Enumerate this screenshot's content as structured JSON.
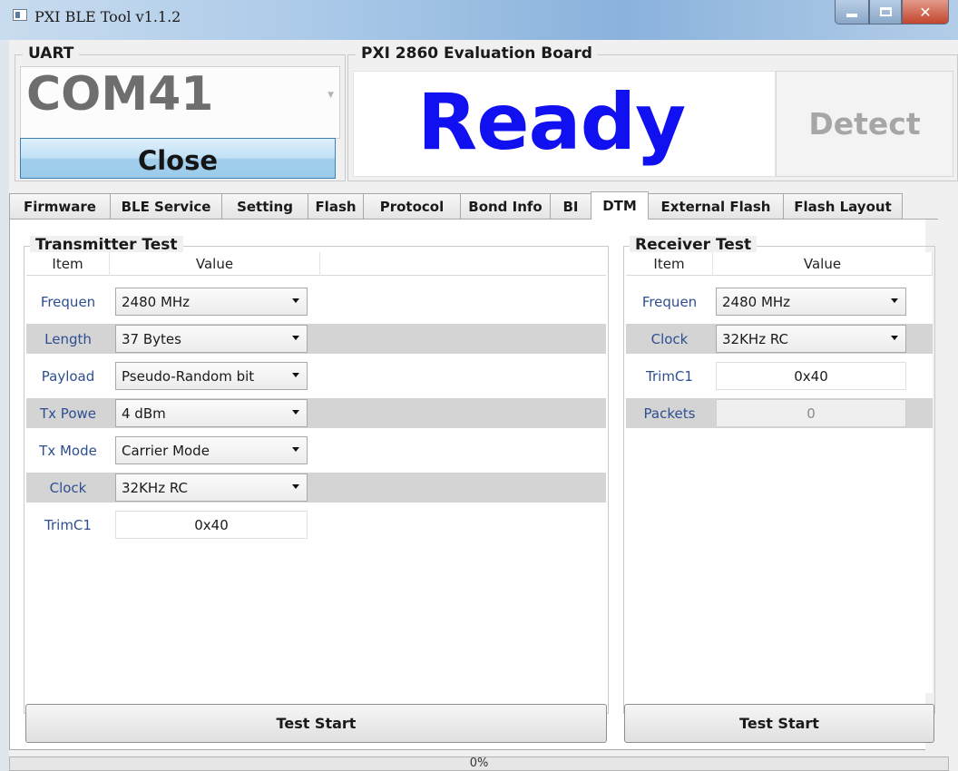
{
  "window": {
    "title": "PXI BLE Tool v1.1.2"
  },
  "uart": {
    "group_label": "UART",
    "port": "COM41",
    "close_label": "Close"
  },
  "board": {
    "group_label": "PXI 2860 Evaluation Board",
    "status": "Ready",
    "status_color": "#1010f0",
    "detect_label": "Detect"
  },
  "tabs": [
    {
      "label": "Firmware"
    },
    {
      "label": "BLE Service"
    },
    {
      "label": "Setting"
    },
    {
      "label": "Flash"
    },
    {
      "label": "Protocol"
    },
    {
      "label": "Bond Info"
    },
    {
      "label": "BI"
    },
    {
      "label": "DTM",
      "active": true
    },
    {
      "label": "External Flash"
    },
    {
      "label": "Flash Layout"
    }
  ],
  "transmitter": {
    "group_label": "Transmitter Test",
    "columns": [
      "Item",
      "Value"
    ],
    "rows": [
      {
        "label": "Frequen",
        "value": "2480 MHz",
        "kind": "combo"
      },
      {
        "label": "Length",
        "value": "37 Bytes",
        "kind": "combo"
      },
      {
        "label": "Payload",
        "value": "Pseudo-Random bit",
        "kind": "combo"
      },
      {
        "label": "Tx Powe",
        "value": "4 dBm",
        "kind": "combo"
      },
      {
        "label": "Tx Mode",
        "value": "Carrier Mode",
        "kind": "combo"
      },
      {
        "label": "Clock",
        "value": "32KHz RC",
        "kind": "combo"
      },
      {
        "label": "TrimC1",
        "value": "0x40",
        "kind": "text"
      }
    ],
    "start_label": "Test Start"
  },
  "receiver": {
    "group_label": "Receiver Test",
    "columns": [
      "Item",
      "Value"
    ],
    "rows": [
      {
        "label": "Frequen",
        "value": "2480 MHz",
        "kind": "combo"
      },
      {
        "label": "Clock",
        "value": "32KHz RC",
        "kind": "combo"
      },
      {
        "label": "TrimC1",
        "value": "0x40",
        "kind": "text"
      },
      {
        "label": "Packets",
        "value": "0",
        "kind": "disabled"
      }
    ],
    "start_label": "Test Start"
  },
  "progress": {
    "percent_text": "0%",
    "value": 0
  }
}
